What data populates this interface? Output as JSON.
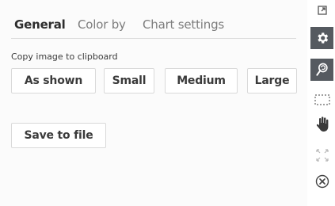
{
  "tabs": [
    {
      "label": "General",
      "active": true
    },
    {
      "label": "Color by",
      "active": false
    },
    {
      "label": "Chart settings",
      "active": false
    }
  ],
  "copy_section": {
    "label": "Copy image to clipboard",
    "buttons": [
      "As shown",
      "Small",
      "Medium",
      "Large"
    ]
  },
  "save_button": "Save to file",
  "toolbar": {
    "icons": [
      "expand-icon",
      "gear-icon",
      "search-reset-icon",
      "marquee-select-icon",
      "pan-hand-icon",
      "fit-to-window-icon",
      "close-icon"
    ]
  },
  "colors": {
    "toolbar_active": "#555a60",
    "panel_bg": "#fbfbfb"
  }
}
